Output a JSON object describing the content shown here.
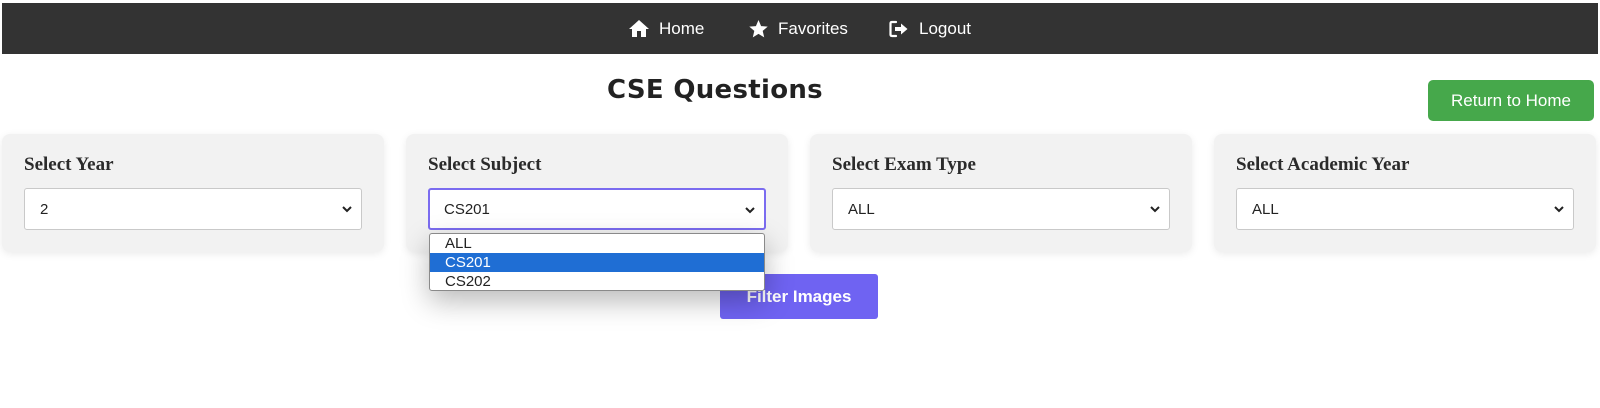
{
  "nav": {
    "items": [
      {
        "label": "Home",
        "icon": "home-icon"
      },
      {
        "label": "Favorites",
        "icon": "star-icon"
      },
      {
        "label": "Logout",
        "icon": "logout-icon"
      }
    ]
  },
  "page": {
    "title": "CSE Questions",
    "return_button": "Return to Home",
    "filter_button": "Filter Images"
  },
  "filters": [
    {
      "label": "Select Year",
      "value": "2"
    },
    {
      "label": "Select Subject",
      "value": "CS201"
    },
    {
      "label": "Select Exam Type",
      "value": "ALL"
    },
    {
      "label": "Select Academic Year",
      "value": "ALL"
    }
  ],
  "subject_dropdown": {
    "options": [
      "ALL",
      "CS201",
      "CS202"
    ],
    "selected": "CS201"
  },
  "colors": {
    "navbar": "#333333",
    "return_button": "#46a84b",
    "filter_button": "#6f63f2",
    "option_highlight": "#1f6ed4",
    "select_focus": "#7b6cf0"
  }
}
